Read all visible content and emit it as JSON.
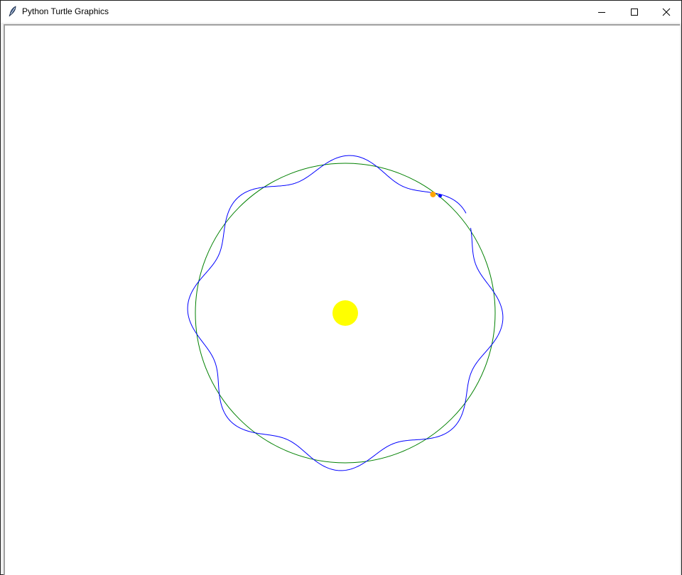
{
  "window": {
    "title": "Python Turtle Graphics",
    "icon": "feather-icon"
  },
  "title_buttons": {
    "minimize_icon": "minimize-icon",
    "maximize_icon": "maximize-icon",
    "close_icon": "close-icon"
  },
  "canvas": {
    "background": "#ffffff",
    "sun_color": "#ffff00",
    "planet_orbit_color": "#008000",
    "moon_path_color": "#0000ff",
    "planet_color": "#ffa500",
    "moon_color": "#0000ff",
    "moon_loops": 8
  }
}
